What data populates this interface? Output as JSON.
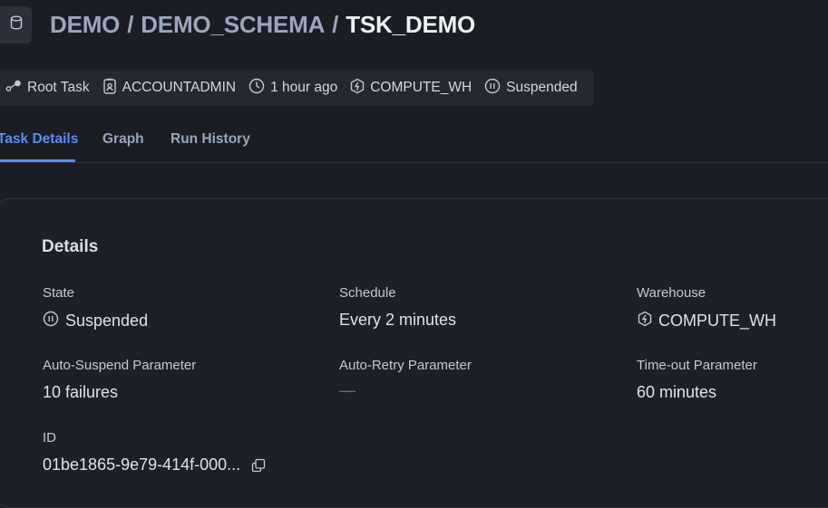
{
  "header": {
    "path_database": "DEMO",
    "path_schema": "DEMO_SCHEMA",
    "path_task": "TSK_DEMO",
    "separator": "/"
  },
  "meta": {
    "root_task": "Root Task",
    "owner": "ACCOUNTADMIN",
    "updated": "1 hour ago",
    "warehouse": "COMPUTE_WH",
    "status": "Suspended"
  },
  "tabs": [
    {
      "label": "Task Details",
      "active": true
    },
    {
      "label": "Graph",
      "active": false
    },
    {
      "label": "Run History",
      "active": false
    }
  ],
  "details": {
    "title": "Details",
    "state_label": "State",
    "state_value": "Suspended",
    "schedule_label": "Schedule",
    "schedule_value": "Every 2 minutes",
    "warehouse_label": "Warehouse",
    "warehouse_value": "COMPUTE_WH",
    "auto_suspend_label": "Auto-Suspend Parameter",
    "auto_suspend_value": "10 failures",
    "auto_retry_label": "Auto-Retry Parameter",
    "auto_retry_value": "—",
    "timeout_label": "Time-out Parameter",
    "timeout_value": "60 minutes",
    "id_label": "ID",
    "id_value": "01be1865-9e79-414f-000..."
  },
  "colors": {
    "background": "#1a1d24",
    "accent": "#5b8def",
    "muted_text": "#9aa6bd"
  },
  "icons": [
    "database-icon",
    "root-task-icon",
    "role-icon",
    "clock-icon",
    "warehouse-icon",
    "pause-icon",
    "copy-icon"
  ]
}
